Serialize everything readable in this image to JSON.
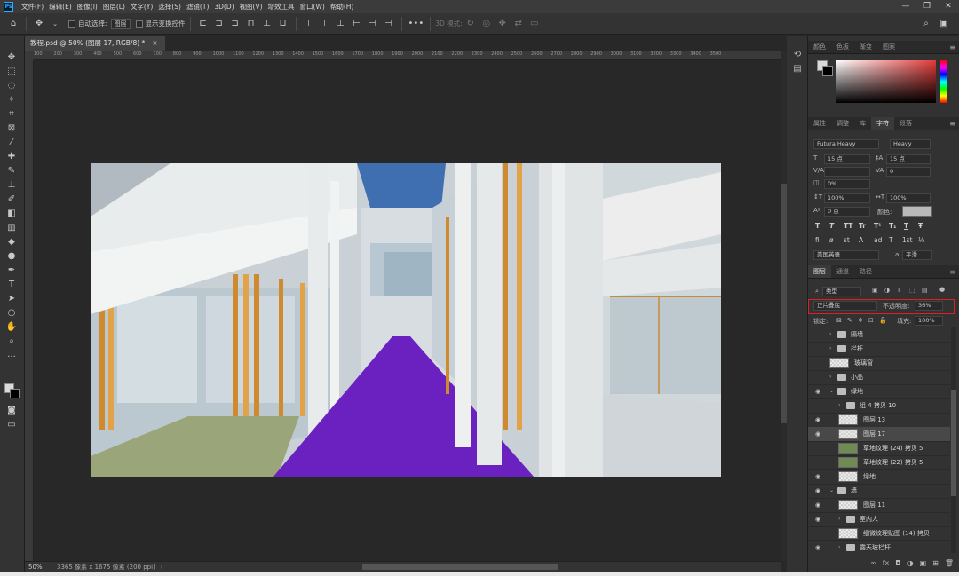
{
  "app": {
    "logo": "Ps"
  },
  "menu": [
    "文件(F)",
    "编辑(E)",
    "图像(I)",
    "图层(L)",
    "文字(Y)",
    "选择(S)",
    "滤镜(T)",
    "3D(D)",
    "视图(V)",
    "增效工具",
    "窗口(W)",
    "帮助(H)"
  ],
  "window_controls": {
    "minimize": "—",
    "restore": "❐",
    "close": "✕"
  },
  "options": {
    "auto_select_label": "自动选择:",
    "auto_select_value": "图层",
    "transform_label": "显示变换控件",
    "mode_3d_label": "3D 模式:"
  },
  "document": {
    "tab_title": "教程.psd @ 50% (图层 17, RGB/8) *",
    "close": "×",
    "zoom": "50%",
    "info": "3365 像素 x 1675 像素 (200 ppi)"
  },
  "ruler_ticks": [
    "100",
    "200",
    "300",
    "400",
    "500",
    "600",
    "700",
    "800",
    "900",
    "1000",
    "1100",
    "1200",
    "1300",
    "1400",
    "1500",
    "1600",
    "1700",
    "1800",
    "1900",
    "2000",
    "2100",
    "2200",
    "2300",
    "2400",
    "2500",
    "2600",
    "2700",
    "2800",
    "2900",
    "3000",
    "3100",
    "3200",
    "3300",
    "3400",
    "3500"
  ],
  "color_panel": {
    "tabs": [
      "颜色",
      "色板",
      "渐变",
      "图案"
    ],
    "active": 0
  },
  "character_panel": {
    "tabs": [
      "属性",
      "调整",
      "库",
      "字符",
      "段落"
    ],
    "active": 3,
    "font_family": "Futura Heavy",
    "font_style": "Heavy",
    "font_size": "15 点",
    "leading": "15 点",
    "va_label": "V/A",
    "kerning": "0",
    "tracking": "0%",
    "vscale": "100%",
    "hscale": "100%",
    "baseline": "0 点",
    "color_label": "颜色:",
    "type_buttons": [
      "T",
      "T",
      "TT",
      "Tr",
      "T¹",
      "T₁",
      "T",
      "Ŧ"
    ],
    "opentype_buttons": [
      "fi",
      "ø",
      "st",
      "A",
      "ad",
      "T",
      "1st",
      "½"
    ],
    "language": "美国英语",
    "aa_label": "a",
    "aa_value": "平滑"
  },
  "layers_panel": {
    "tabs": [
      "图层",
      "通道",
      "路径"
    ],
    "active": 0,
    "filter_kind": "类型",
    "blend_mode": "正片叠底",
    "opacity_label": "不透明度:",
    "opacity_value": "36%",
    "lock_label": "锁定:",
    "fill_label": "填充:",
    "fill_value": "100%",
    "layers": [
      {
        "name": "隔墙",
        "type": "group",
        "indent": 0,
        "visible": false,
        "selected": false
      },
      {
        "name": "栏杆",
        "type": "group",
        "indent": 0,
        "visible": false,
        "selected": false
      },
      {
        "name": "玻璃窗",
        "type": "layer",
        "indent": 0,
        "visible": false,
        "selected": false
      },
      {
        "name": "小品",
        "type": "group",
        "indent": 0,
        "visible": false,
        "selected": false
      },
      {
        "name": "绿地",
        "type": "group",
        "indent": 0,
        "visible": true,
        "selected": false,
        "open": true
      },
      {
        "name": "组 4 拷贝 10",
        "type": "group",
        "indent": 1,
        "visible": false,
        "selected": false
      },
      {
        "name": "图层 13",
        "type": "layer",
        "indent": 1,
        "visible": true,
        "selected": false
      },
      {
        "name": "图层 17",
        "type": "layer",
        "indent": 1,
        "visible": true,
        "selected": true
      },
      {
        "name": "草地纹理 (24) 拷贝 5",
        "type": "layer",
        "indent": 1,
        "visible": false,
        "selected": false,
        "grass": true
      },
      {
        "name": "草地纹理 (22) 拷贝 5",
        "type": "layer",
        "indent": 1,
        "visible": false,
        "selected": false,
        "grass": true
      },
      {
        "name": "绿地",
        "type": "layer",
        "indent": 1,
        "visible": true,
        "selected": false
      },
      {
        "name": "墙",
        "type": "group",
        "indent": 0,
        "visible": true,
        "selected": false,
        "open": true
      },
      {
        "name": "图层 11",
        "type": "layer",
        "indent": 1,
        "visible": true,
        "selected": false
      },
      {
        "name": "室内人",
        "type": "group",
        "indent": 1,
        "visible": true,
        "selected": false
      },
      {
        "name": "细微纹理贴图 (14) 拷贝",
        "type": "layer",
        "indent": 1,
        "visible": false,
        "selected": false
      },
      {
        "name": "露天玻栏杆",
        "type": "group",
        "indent": 1,
        "visible": true,
        "selected": false
      }
    ],
    "footer_icons": [
      "∞",
      "fx",
      "◘",
      "◑",
      "▣",
      "⊞",
      "🗑"
    ]
  }
}
